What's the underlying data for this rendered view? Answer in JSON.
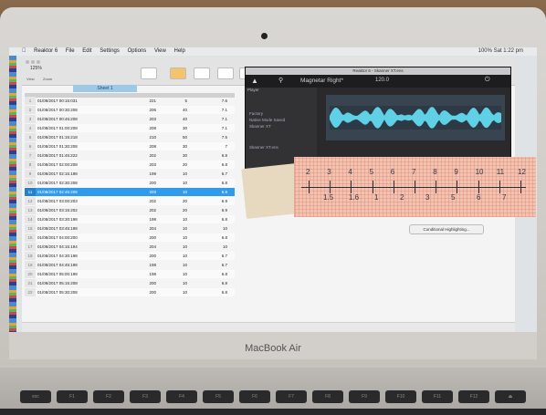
{
  "menubar": {
    "items": [
      "Reaktor 6",
      "File",
      "Edit",
      "Settings",
      "Options",
      "View",
      "Help"
    ],
    "right": "100%  Sat 1:22 pm"
  },
  "numbers": {
    "zoom": "125%",
    "view_label": "View",
    "zoom_caption": "Zoom",
    "sheet_tab": "Sheet 1",
    "conditional_button": "Conditional Highlighting...",
    "selected_row_index": 10,
    "rows": [
      {
        "n": "1",
        "date": "01/08/2017 00:15:031",
        "c1": "221",
        "c2": "5",
        "c3": "7.6"
      },
      {
        "n": "2",
        "date": "01/08/2017 00:30:208",
        "c1": "206",
        "c2": "40",
        "c3": "7.1"
      },
      {
        "n": "3",
        "date": "01/08/2017 00:45:208",
        "c1": "203",
        "c2": "40",
        "c3": "7.1"
      },
      {
        "n": "4",
        "date": "01/08/2017 01:00:208",
        "c1": "208",
        "c2": "30",
        "c3": "7.1"
      },
      {
        "n": "5",
        "date": "01/08/2017 01:15:218",
        "c1": "210",
        "c2": "50",
        "c3": "7.5"
      },
      {
        "n": "6",
        "date": "01/08/2017 01:30:208",
        "c1": "208",
        "c2": "30",
        "c3": "7"
      },
      {
        "n": "7",
        "date": "01/08/2017 01:45:222",
        "c1": "202",
        "c2": "30",
        "c3": "6.8"
      },
      {
        "n": "8",
        "date": "01/08/2017 02:00:208",
        "c1": "203",
        "c2": "20",
        "c3": "6.8"
      },
      {
        "n": "9",
        "date": "01/08/2017 02:15:198",
        "c1": "199",
        "c2": "10",
        "c3": "6.7"
      },
      {
        "n": "10",
        "date": "01/08/2017 02:30:208",
        "c1": "200",
        "c2": "10",
        "c3": "6.8"
      },
      {
        "n": "11",
        "date": "01/08/2017 02:45:208",
        "c1": "203",
        "c2": "10",
        "c3": "6.8"
      },
      {
        "n": "12",
        "date": "01/08/2017 03:00:203",
        "c1": "202",
        "c2": "20",
        "c3": "6.9"
      },
      {
        "n": "13",
        "date": "01/08/2017 03:15:202",
        "c1": "202",
        "c2": "20",
        "c3": "6.9"
      },
      {
        "n": "14",
        "date": "01/08/2017 03:30:198",
        "c1": "198",
        "c2": "10",
        "c3": "6.8"
      },
      {
        "n": "15",
        "date": "01/08/2017 03:45:198",
        "c1": "204",
        "c2": "10",
        "c3": "10"
      },
      {
        "n": "16",
        "date": "01/08/2017 04:00:200",
        "c1": "200",
        "c2": "10",
        "c3": "6.8"
      },
      {
        "n": "17",
        "date": "01/08/2017 04:15:194",
        "c1": "204",
        "c2": "10",
        "c3": "10"
      },
      {
        "n": "18",
        "date": "01/08/2017 04:30:198",
        "c1": "200",
        "c2": "10",
        "c3": "6.7"
      },
      {
        "n": "19",
        "date": "01/08/2017 04:45:198",
        "c1": "198",
        "c2": "10",
        "c3": "6.7"
      },
      {
        "n": "20",
        "date": "01/08/2017 05:00:198",
        "c1": "198",
        "c2": "10",
        "c3": "6.8"
      },
      {
        "n": "21",
        "date": "01/08/2017 05:15:208",
        "c1": "200",
        "c2": "10",
        "c3": "6.8"
      },
      {
        "n": "22",
        "date": "01/08/2017 05:30:208",
        "c1": "200",
        "c2": "10",
        "c3": "6.8"
      }
    ]
  },
  "reaktor": {
    "title": "Reaktor 6 - Skanner XT.ens",
    "instrument": "Magnetar Right*",
    "bpm": "120.0",
    "browser_tab_player": "Player",
    "browser_items": [
      "Player",
      "Factory",
      "Native Mode Saved",
      "Skanner XT",
      "Skanner XT.ens"
    ]
  },
  "ruler": {
    "top_numbers": [
      "2",
      "3",
      "4",
      "5",
      "6",
      "7",
      "8",
      "9",
      "10",
      "11",
      "12"
    ],
    "bottom_numbers": [
      "1.5",
      "1.6",
      "1",
      "2",
      "3",
      "5",
      "6",
      "7"
    ]
  },
  "laptop": {
    "brand": "MacBook Air",
    "keys": [
      "esc",
      "F1",
      "F2",
      "F3",
      "F4",
      "F5",
      "F6",
      "F7",
      "F8",
      "F9",
      "F10",
      "F11",
      "F12",
      "⏏"
    ]
  }
}
